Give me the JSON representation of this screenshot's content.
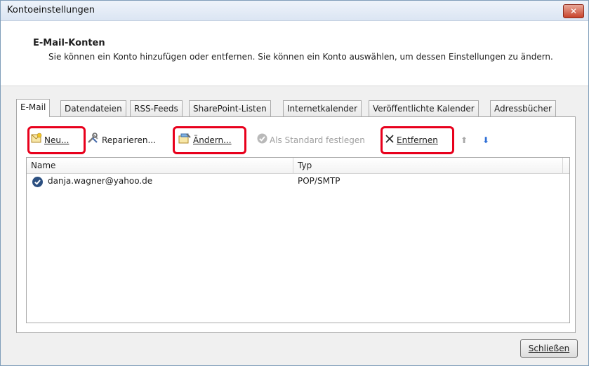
{
  "window": {
    "title": "Kontoeinstellungen",
    "close_glyph": "✕"
  },
  "header": {
    "title": "E-Mail-Konten",
    "description": "Sie können ein Konto hinzufügen oder entfernen. Sie können ein Konto auswählen, um dessen Einstellungen zu ändern."
  },
  "tabs": [
    {
      "label": "E-Mail",
      "active": true
    },
    {
      "label": "Datendateien"
    },
    {
      "label": "RSS-Feeds"
    },
    {
      "label": "SharePoint-Listen"
    },
    {
      "label": "Internetkalender"
    },
    {
      "label": "Veröffentlichte Kalender"
    },
    {
      "label": "Adressbücher"
    }
  ],
  "toolbar": {
    "new_label": "Neu...",
    "repair_label": "Reparieren...",
    "change_label": "Ändern...",
    "set_default_label": "Als Standard festlegen",
    "remove_label": "Entfernen",
    "up_glyph": "⬆",
    "down_glyph": "⬇"
  },
  "list": {
    "columns": {
      "name": "Name",
      "type": "Typ"
    },
    "rows": [
      {
        "name": "danja.wagner@yahoo.de",
        "type": "POP/SMTP"
      }
    ]
  },
  "footer": {
    "close_label": "Schließen"
  },
  "colors": {
    "highlight": "#e8001c",
    "up_arrow": "#a8a8a8",
    "down_arrow": "#2f6fd6"
  }
}
